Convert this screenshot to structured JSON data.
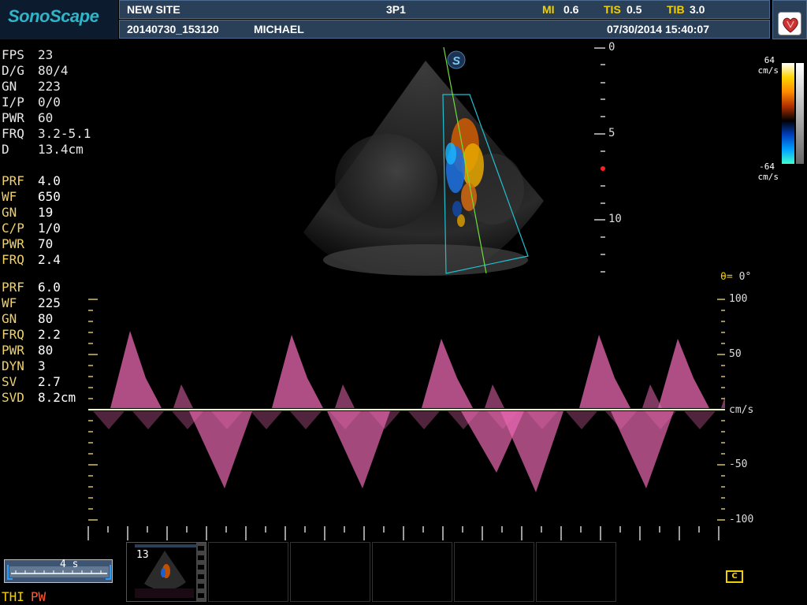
{
  "header": {
    "logo": "SonoScape",
    "site": "NEW SITE",
    "probe": "3P1",
    "mi_label": "MI",
    "mi_value": "0.6",
    "tis_label": "TIS",
    "tis_value": "0.5",
    "tib_label": "TIB",
    "tib_value": "3.0",
    "exam_id": "20140730_153120",
    "patient": "MICHAEL",
    "datetime": "07/30/2014 15:40:07",
    "preset_icon": "heart-icon"
  },
  "bmode_params": [
    {
      "k": "FPS",
      "v": "23"
    },
    {
      "k": "D/G",
      "v": "80/4"
    },
    {
      "k": "GN",
      "v": "223"
    },
    {
      "k": "I/P",
      "v": "0/0"
    },
    {
      "k": "PWR",
      "v": "60"
    },
    {
      "k": "FRQ",
      "v": "3.2-5.1"
    },
    {
      "k": "D",
      "v": "13.4cm"
    }
  ],
  "color_params": [
    {
      "k": "PRF",
      "v": "4.0"
    },
    {
      "k": "WF",
      "v": "650"
    },
    {
      "k": "GN",
      "v": "19"
    },
    {
      "k": "C/P",
      "v": "1/0"
    },
    {
      "k": "PWR",
      "v": "70"
    },
    {
      "k": "FRQ",
      "v": "2.4"
    }
  ],
  "pw_params": [
    {
      "k": "PRF",
      "v": "6.0"
    },
    {
      "k": "WF",
      "v": "225"
    },
    {
      "k": "GN",
      "v": "80"
    },
    {
      "k": "FRQ",
      "v": "2.2"
    },
    {
      "k": "PWR",
      "v": "80"
    },
    {
      "k": "DYN",
      "v": "3"
    },
    {
      "k": "SV",
      "v": "2.7"
    },
    {
      "k": "SVD",
      "v": "8.2cm"
    }
  ],
  "depth_scale": {
    "labels": [
      "0",
      "5",
      "10"
    ]
  },
  "colorbar": {
    "top": "64",
    "bottom": "-64",
    "unit": "cm/s",
    "colors": [
      "#ffffff",
      "#ffd400",
      "#ff8a00",
      "#b03000",
      "#000000",
      "#0040c0",
      "#00a0ff",
      "#40ffd0"
    ]
  },
  "doppler": {
    "theta_label": "θ=",
    "theta_value": "0°",
    "vel_labels": [
      "100",
      "50",
      "cm/s",
      "-50",
      "-100"
    ],
    "trace_color": "#e868b0"
  },
  "timebar": {
    "label": "4 s"
  },
  "modes": {
    "thi": "THI",
    "pw": "PW"
  },
  "thumbnails": [
    {
      "num": "13"
    },
    {
      "num": ""
    },
    {
      "num": ""
    },
    {
      "num": ""
    },
    {
      "num": ""
    },
    {
      "num": ""
    }
  ],
  "cine_icon": "C"
}
